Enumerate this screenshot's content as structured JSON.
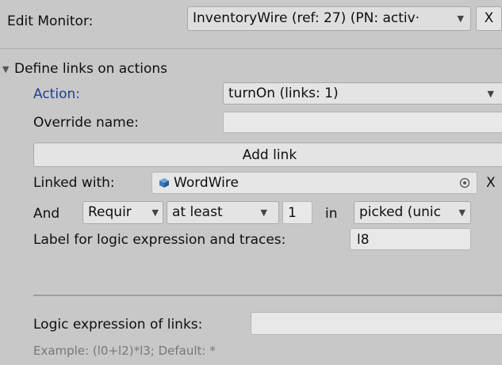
{
  "header": {
    "label": "Edit Monitor:",
    "monitor_value": "InventoryWire (ref: 27) (PN: activ‧",
    "close": "X"
  },
  "section": {
    "title": "Define links on actions",
    "action_label": "Action:",
    "action_value": "turnOn (links: 1)",
    "override_label": "Override name:",
    "override_value": "",
    "add_link": "Add link",
    "linked_label": "Linked with:",
    "linked_value": "WordWire",
    "linked_remove": "X",
    "and_label": "And",
    "require_value": "Requir",
    "atleast_value": "at least",
    "count_value": "1",
    "in_label": "in",
    "picked_value": "picked (unic",
    "logic_label": "Label for logic expression and traces:",
    "logic_value": "l8",
    "logic_expr_label": "Logic expression of links:",
    "logic_expr_value": "",
    "example": "Example: (l0+l2)*l3; Default: *"
  },
  "colors": {
    "action_label": "#1f3f8a",
    "background": "#c8c8c8",
    "example": "#777777"
  },
  "icons": [
    "foldout-arrow-icon",
    "dropdown-caret-icon",
    "object-picker-icon",
    "gameobject-icon"
  ]
}
